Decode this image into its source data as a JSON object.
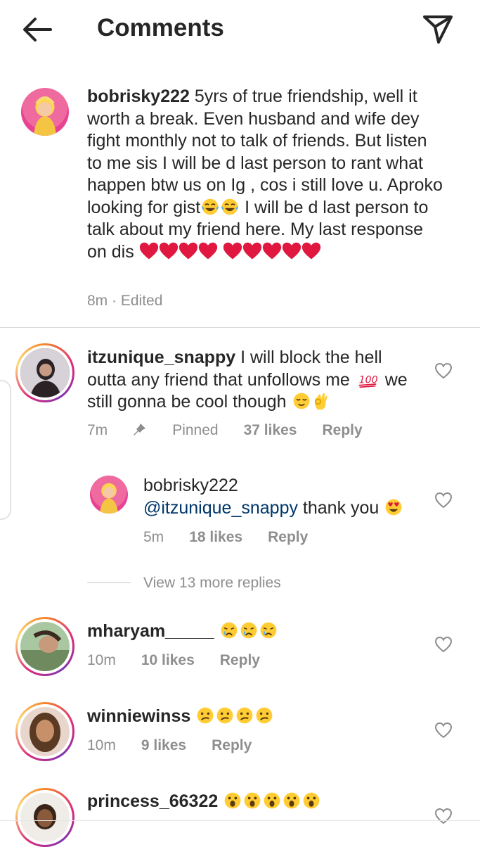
{
  "header": {
    "title": "Comments"
  },
  "caption": {
    "username": "bobrisky222",
    "text_parts": [
      " 5yrs of true friendship, well it worth a break. Even husband and wife dey fight monthly not to talk of friends. But listen to me sis I will be d last person to rant what happen btw us on Ig , cos i still love u. Aproko looking for gist",
      " I will be d last person to talk about my friend here. My last response on dis "
    ],
    "time": "8m",
    "edited": "Edited",
    "separator": "·"
  },
  "comments": [
    {
      "username": "itzunique_snappy",
      "text_parts": [
        " I will block the hell outta any friend that unfollows me ",
        " we still gonna be cool though "
      ],
      "time": "7m",
      "pinned": "Pinned",
      "likes": "37 likes",
      "reply": "Reply",
      "replies": [
        {
          "username": "bobrisky222",
          "mention": "@itzunique_snappy",
          "text": " thank you ",
          "time": "5m",
          "likes": "18 likes",
          "reply": "Reply"
        }
      ],
      "view_more": "View 13 more replies"
    },
    {
      "username": "mharyam_____",
      "time": "10m",
      "likes": "10 likes",
      "reply": "Reply"
    },
    {
      "username": "winniewinss",
      "time": "10m",
      "likes": "9 likes",
      "reply": "Reply"
    },
    {
      "username": "princess_66322"
    }
  ],
  "icons": {
    "back": "arrow-left-icon",
    "send": "paper-plane-icon",
    "like": "heart-outline-icon",
    "pin": "pin-icon",
    "tears_of_joy": "face-with-tears-of-joy-emoji",
    "red_heart": "red-heart-emoji",
    "hundred": "hundred-points-emoji",
    "relieved": "relieved-face-emoji",
    "ok_hand": "ok-hand-emoji",
    "heart_eyes": "smiling-face-with-heart-eyes-emoji",
    "crying": "crying-face-emoji",
    "confused": "confused-face-emoji",
    "astonished": "astonished-face-emoji"
  },
  "colors": {
    "text": "#262626",
    "secondary": "#8e8e8e",
    "mention": "#00376b",
    "heart": "#e0173f",
    "emoji": "#ffcc33"
  }
}
